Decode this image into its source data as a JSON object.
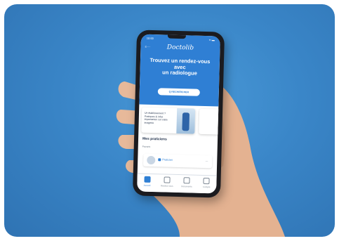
{
  "status": {
    "time": "10:00",
    "right": "▪▪ ▬"
  },
  "app": {
    "logo": "Doctolib",
    "menu": "≡ ⋯"
  },
  "hero": {
    "headline_1": "Trouvez un rendez-vous",
    "headline_2": "avec",
    "headline_3": "un radiologue",
    "cta": "Q RECHERCHER"
  },
  "card": {
    "text": "Un établissement ? Pratiques & infos importantes sur votre imagerie"
  },
  "section": {
    "title": "Mes praticiens",
    "subtitle": "Favoris"
  },
  "practitioner": {
    "label": "Praticien",
    "value": "—"
  },
  "tabs": [
    {
      "label": "Accueil",
      "icon": "home-icon"
    },
    {
      "label": "Rendez-vous",
      "icon": "calendar-icon"
    },
    {
      "label": "Documents",
      "icon": "document-icon"
    },
    {
      "label": "Compte",
      "icon": "user-icon"
    }
  ],
  "colors": {
    "background": "#3a86c8",
    "brand": "#2f7fd4",
    "skin": "#e7b99a"
  }
}
